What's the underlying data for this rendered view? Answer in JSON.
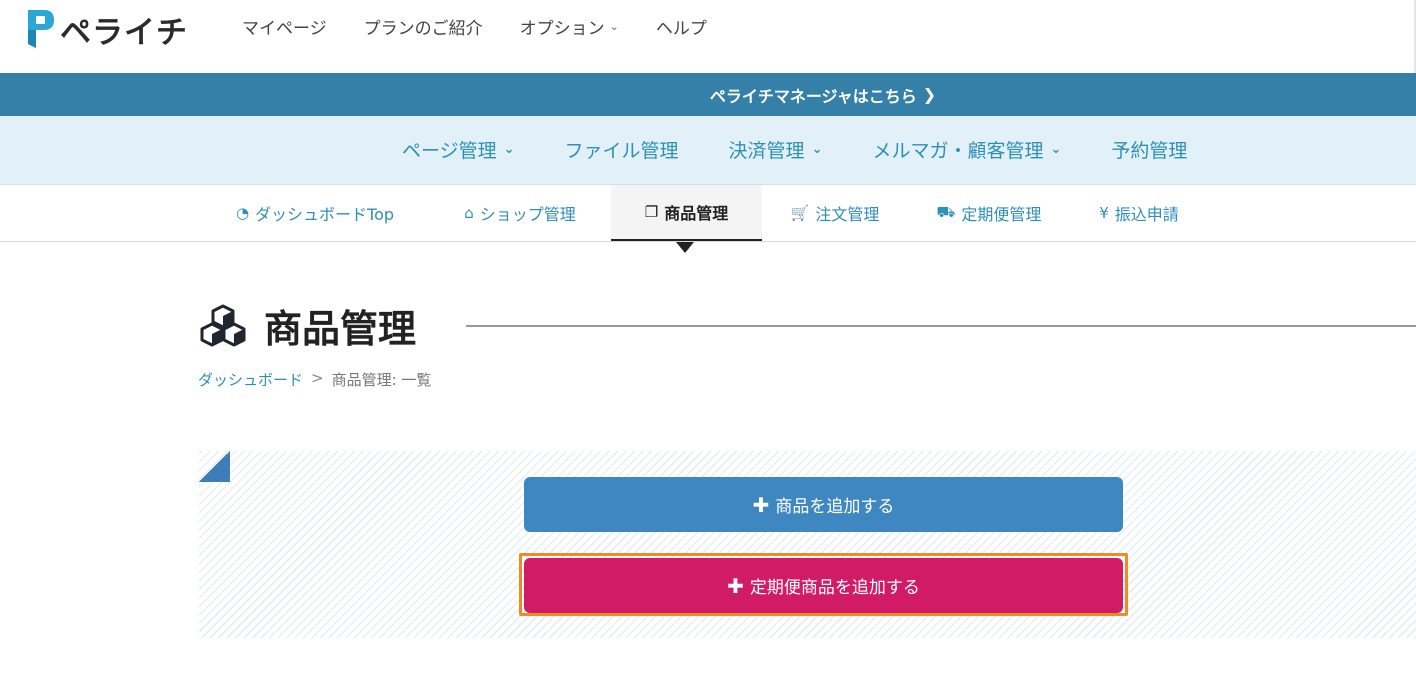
{
  "header": {
    "logo_text": "ペライチ",
    "nav": [
      {
        "label": "マイページ",
        "has_dropdown": false
      },
      {
        "label": "プランのご紹介",
        "has_dropdown": false
      },
      {
        "label": "オプション",
        "has_dropdown": true
      },
      {
        "label": "ヘルプ",
        "has_dropdown": false
      }
    ]
  },
  "banner": {
    "label": "ペライチマネージャはこちら"
  },
  "main_nav": [
    {
      "label": "ページ管理",
      "has_dropdown": true
    },
    {
      "label": "ファイル管理",
      "has_dropdown": false
    },
    {
      "label": "決済管理",
      "has_dropdown": true
    },
    {
      "label": "メルマガ・顧客管理",
      "has_dropdown": true
    },
    {
      "label": "予約管理",
      "has_dropdown": false
    }
  ],
  "sub_nav": [
    {
      "label": "ダッシュボードTop",
      "icon": "dashboard-icon",
      "active": false
    },
    {
      "label": "ショップ管理",
      "icon": "home-icon",
      "active": false
    },
    {
      "label": "商品管理",
      "icon": "cubes-icon",
      "active": true
    },
    {
      "label": "注文管理",
      "icon": "cart-icon",
      "active": false
    },
    {
      "label": "定期便管理",
      "icon": "truck-icon",
      "active": false
    },
    {
      "label": "振込申請",
      "icon": "yen-icon",
      "active": false
    }
  ],
  "page": {
    "title": "商品管理",
    "breadcrumb": [
      {
        "label": "ダッシュボード",
        "link": true
      },
      {
        "label": "商品管理: 一覧",
        "link": false
      }
    ]
  },
  "actions": {
    "add_product": "商品を追加する",
    "add_subscription_product": "定期便商品を追加する"
  },
  "colors": {
    "brand_blue": "#3480a8",
    "link_blue": "#2e8fb8",
    "button_blue": "#3f87c0",
    "button_pink": "#d11b67",
    "highlight_orange": "#f08a24"
  }
}
